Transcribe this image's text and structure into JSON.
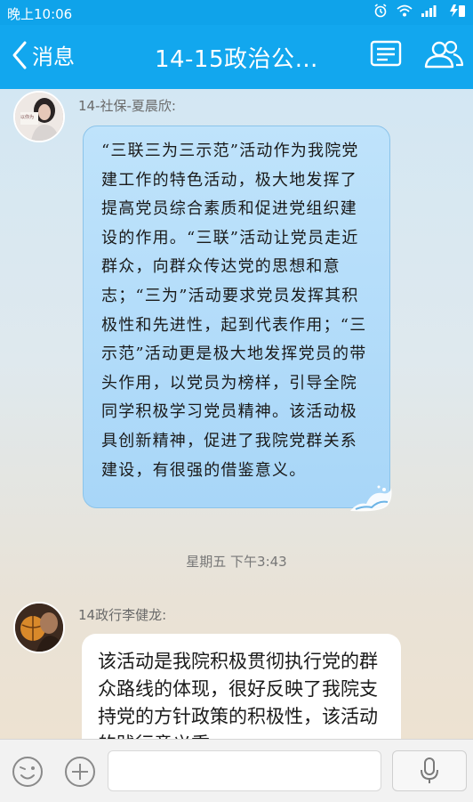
{
  "status_bar": {
    "time": "晚上10:06"
  },
  "nav": {
    "back_label": "消息",
    "title": "14-15政治公…"
  },
  "messages": [
    {
      "sender": "14-社保-夏晨欣:",
      "avatar_text": "以你为",
      "text": "“三联三为三示范”活动作为我院党建工作的特色活动，极大地发挥了提高党员综合素质和促进党组织建设的作用。“三联”活动让党员走近群众，向群众传达党的思想和意志；“三为”活动要求党员发挥其积极性和先进性，起到代表作用；“三示范”活动更是极大地发挥党员的带头作用，以党员为榜样，引导全院同学积极学习党员精神。该活动极具创新精神，促进了我院党群关系建设，有很强的借鉴意义。"
    },
    {
      "sender": "14政行李健龙:",
      "text": "该活动是我院积极贯彻执行党的群众路线的体现，很好反映了我院支持党的方针政策的积极性，该活动的践行意义重"
    }
  ],
  "timestamp": "星期五 下午3:43",
  "colors": {
    "header": "#12a7ee",
    "bubble_blue": "#b5ddfa",
    "bubble_white": "#ffffff"
  },
  "icons": [
    "alarm-icon",
    "wifi-icon",
    "signal-icon",
    "battery-icon",
    "back-chevron-icon",
    "group-files-icon",
    "group-members-icon",
    "emoji-icon",
    "plus-icon",
    "microphone-icon"
  ]
}
